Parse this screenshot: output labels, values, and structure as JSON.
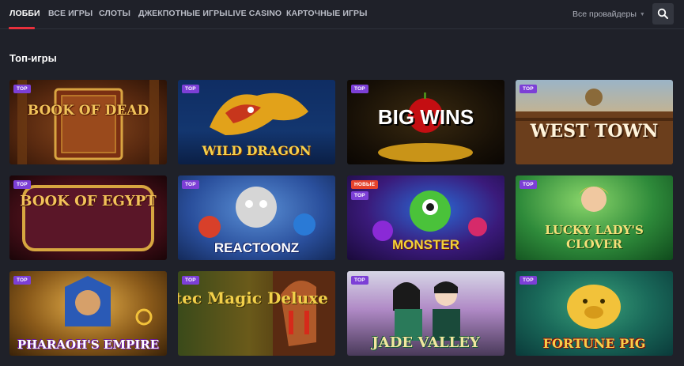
{
  "nav": {
    "tabs": [
      {
        "label": "ЛОББИ",
        "active": true
      },
      {
        "label": "ВСЕ ИГРЫ",
        "active": false
      },
      {
        "label": "СЛОТЫ",
        "active": false
      },
      {
        "label": "ДЖЕКПОТНЫЕ ИГРЫ",
        "active": false
      },
      {
        "label": "LIVE CASINO",
        "active": false
      },
      {
        "label": "КАРТОЧНЫЕ ИГРЫ",
        "active": false
      }
    ],
    "providers_label": "Все провайдеры",
    "search_icon": "search-icon",
    "accent_color": "#e8303c"
  },
  "section": {
    "title": "Топ-игры"
  },
  "games": [
    {
      "title": "BOOK OF DEAD",
      "badges": [
        "TOP"
      ]
    },
    {
      "title": "WILD DRAGON",
      "badges": [
        "TOP"
      ]
    },
    {
      "title": "BIG WINS",
      "badges": [
        "TOP"
      ]
    },
    {
      "title": "WEST TOWN",
      "badges": [
        "TOP"
      ]
    },
    {
      "title": "BOOK OF EGYPT",
      "badges": [
        "TOP"
      ]
    },
    {
      "title": "REACTOONZ",
      "badges": [
        "TOP"
      ]
    },
    {
      "title": "MONSTER",
      "badges": [
        "НОВЫЕ",
        "TOP"
      ]
    },
    {
      "title": "LUCKY LADY'S CLOVER",
      "badges": [
        "TOP"
      ]
    },
    {
      "title": "PHARAOH'S EMPIRE",
      "badges": [
        "TOP"
      ]
    },
    {
      "title": "Aztec Magic Deluxe",
      "badges": [
        "TOP"
      ]
    },
    {
      "title": "JADE VALLEY",
      "badges": [
        "TOP"
      ]
    },
    {
      "title": "FORTUNE PIG",
      "badges": [
        "TOP"
      ]
    }
  ]
}
